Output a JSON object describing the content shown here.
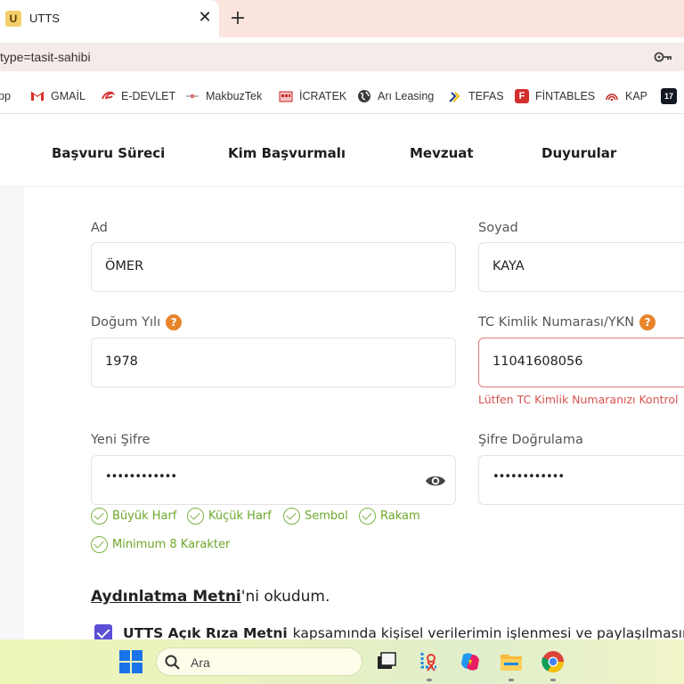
{
  "browser": {
    "tab_title": "UTTS",
    "tab_favicon_letter": "U",
    "close_glyph": "✕",
    "newtab_glyph": "+",
    "url": "type=tasit-sahibi",
    "bookmarks": [
      {
        "label": "pp",
        "icon": "app-icon"
      },
      {
        "label": "GMAİL",
        "icon": "gmail-icon"
      },
      {
        "label": "E-DEVLET",
        "icon": "edevlet-icon"
      },
      {
        "label": "MakbuzTek",
        "icon": "makbuztek-icon"
      },
      {
        "label": "İCRATEK",
        "icon": "icratek-icon"
      },
      {
        "label": "Arı Leasing",
        "icon": "globe-icon"
      },
      {
        "label": "TEFAS",
        "icon": "tefas-icon"
      },
      {
        "label": "FİNTABLES",
        "icon": "fintables-icon"
      },
      {
        "label": "KAP",
        "icon": "kap-icon"
      },
      {
        "label": "",
        "icon": "tradingview-icon"
      }
    ]
  },
  "nav": {
    "items": [
      "Başvuru Süreci",
      "Kim Başvurmalı",
      "Mevzuat",
      "Duyurular"
    ]
  },
  "form": {
    "ad_label": "Ad",
    "ad_value": "ÖMER",
    "soyad_label": "Soyad",
    "soyad_value": "KAYA",
    "dogum_label": "Doğum Yılı",
    "dogum_value": "1978",
    "tc_label": "TC Kimlik Numarası/YKN",
    "tc_value": "11041608056",
    "tc_error": "Lütfen TC Kimlik Numaranızı Kontrol",
    "help_glyph": "?",
    "sifre_label": "Yeni Şifre",
    "sifre_value": "••••••••••••",
    "sifre2_label": "Şifre Doğrulama",
    "sifre2_value": "••••••••••••",
    "rules": [
      "Büyük Harf",
      "Küçük Harf",
      "Sembol",
      "Rakam",
      "Minimum 8 Karakter"
    ],
    "aydinlatma_link": "Aydınlatma Metni",
    "aydinlatma_rest": "'ni okudum.",
    "consent_link": "UTTS Açık Rıza Metni",
    "consent_rest": "kapsamında kişisel verilerimin işlenmesi ve paylaşılmasına"
  },
  "taskbar": {
    "search_placeholder": "Ara"
  },
  "colors": {
    "accent": "#5b4fd8",
    "help": "#e8842a",
    "success": "#7cb342",
    "error": "#d9534f"
  }
}
